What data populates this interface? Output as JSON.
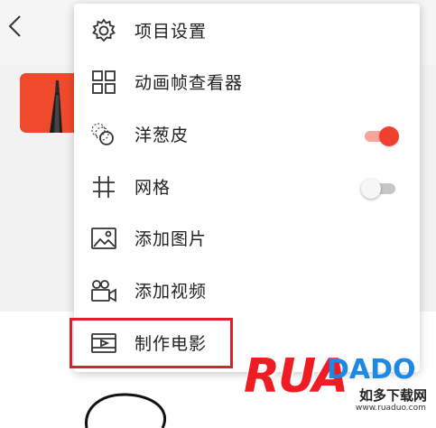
{
  "menu": {
    "items": [
      {
        "label": "项目设置",
        "icon": "gear-icon"
      },
      {
        "label": "动画帧查看器",
        "icon": "grid-icon"
      },
      {
        "label": "洋葱皮",
        "icon": "onion-skin-icon",
        "toggle": "on"
      },
      {
        "label": "网格",
        "icon": "grid-lines-icon",
        "toggle": "off"
      },
      {
        "label": "添加图片",
        "icon": "image-icon"
      },
      {
        "label": "添加视频",
        "icon": "video-camera-icon"
      },
      {
        "label": "制作电影",
        "icon": "film-icon"
      }
    ]
  },
  "colors": {
    "accent": "#f0402f",
    "highlight": "#d9232a",
    "thumbnail": "#f04a2c"
  },
  "watermark": {
    "logo_main": "RUA",
    "logo_accent": "DADO",
    "site_name": "如多下载网",
    "site_url": "www.ruaduo.com"
  }
}
